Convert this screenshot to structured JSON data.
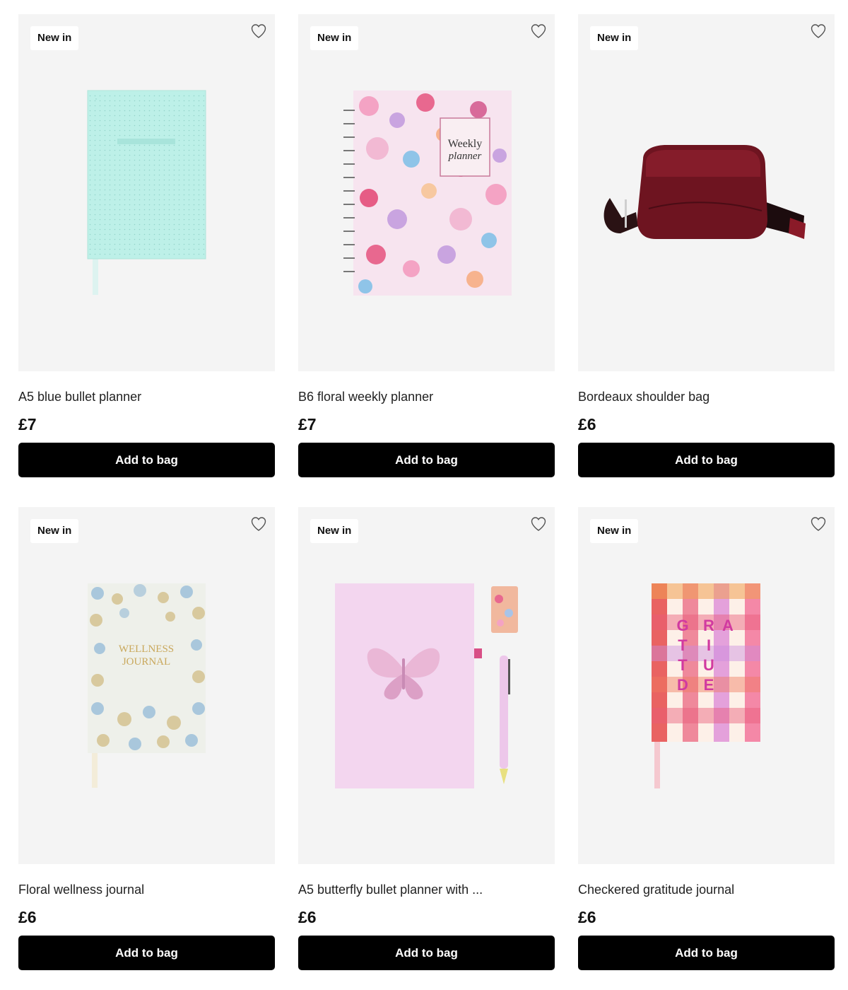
{
  "products": [
    {
      "badge": "New in",
      "title": "A5 blue bullet planner",
      "price": "£7",
      "button": "Add to bag",
      "image_icon": "blue-planner-image",
      "accent": "#bdf0e8"
    },
    {
      "badge": "New in",
      "title": "B6 floral weekly planner",
      "price": "£7",
      "button": "Add to bag",
      "image_icon": "floral-planner-image",
      "accent": "#f2c6e0",
      "cover_text_line1": "Weekly",
      "cover_text_line2": "planner"
    },
    {
      "badge": "New in",
      "title": "Bordeaux shoulder bag",
      "price": "£6",
      "button": "Add to bag",
      "image_icon": "bag-image",
      "accent": "#6e1420"
    },
    {
      "badge": "New in",
      "title": "Floral wellness journal",
      "price": "£6",
      "button": "Add to bag",
      "image_icon": "wellness-journal-image",
      "accent": "#dfe6e8",
      "cover_text_line1": "WELLNESS",
      "cover_text_line2": "JOURNAL"
    },
    {
      "badge": "New in",
      "title": "A5 butterfly bullet planner with ...",
      "price": "£6",
      "button": "Add to bag",
      "image_icon": "butterfly-planner-image",
      "accent": "#f3d6ef"
    },
    {
      "badge": "New in",
      "title": "Checkered gratitude journal",
      "price": "£6",
      "button": "Add to bag",
      "image_icon": "gratitude-journal-image",
      "accent": "#e85c7a",
      "cover_letters": [
        "G",
        "R",
        "A",
        "T",
        "I",
        "T",
        "U",
        "D",
        "E"
      ]
    }
  ]
}
